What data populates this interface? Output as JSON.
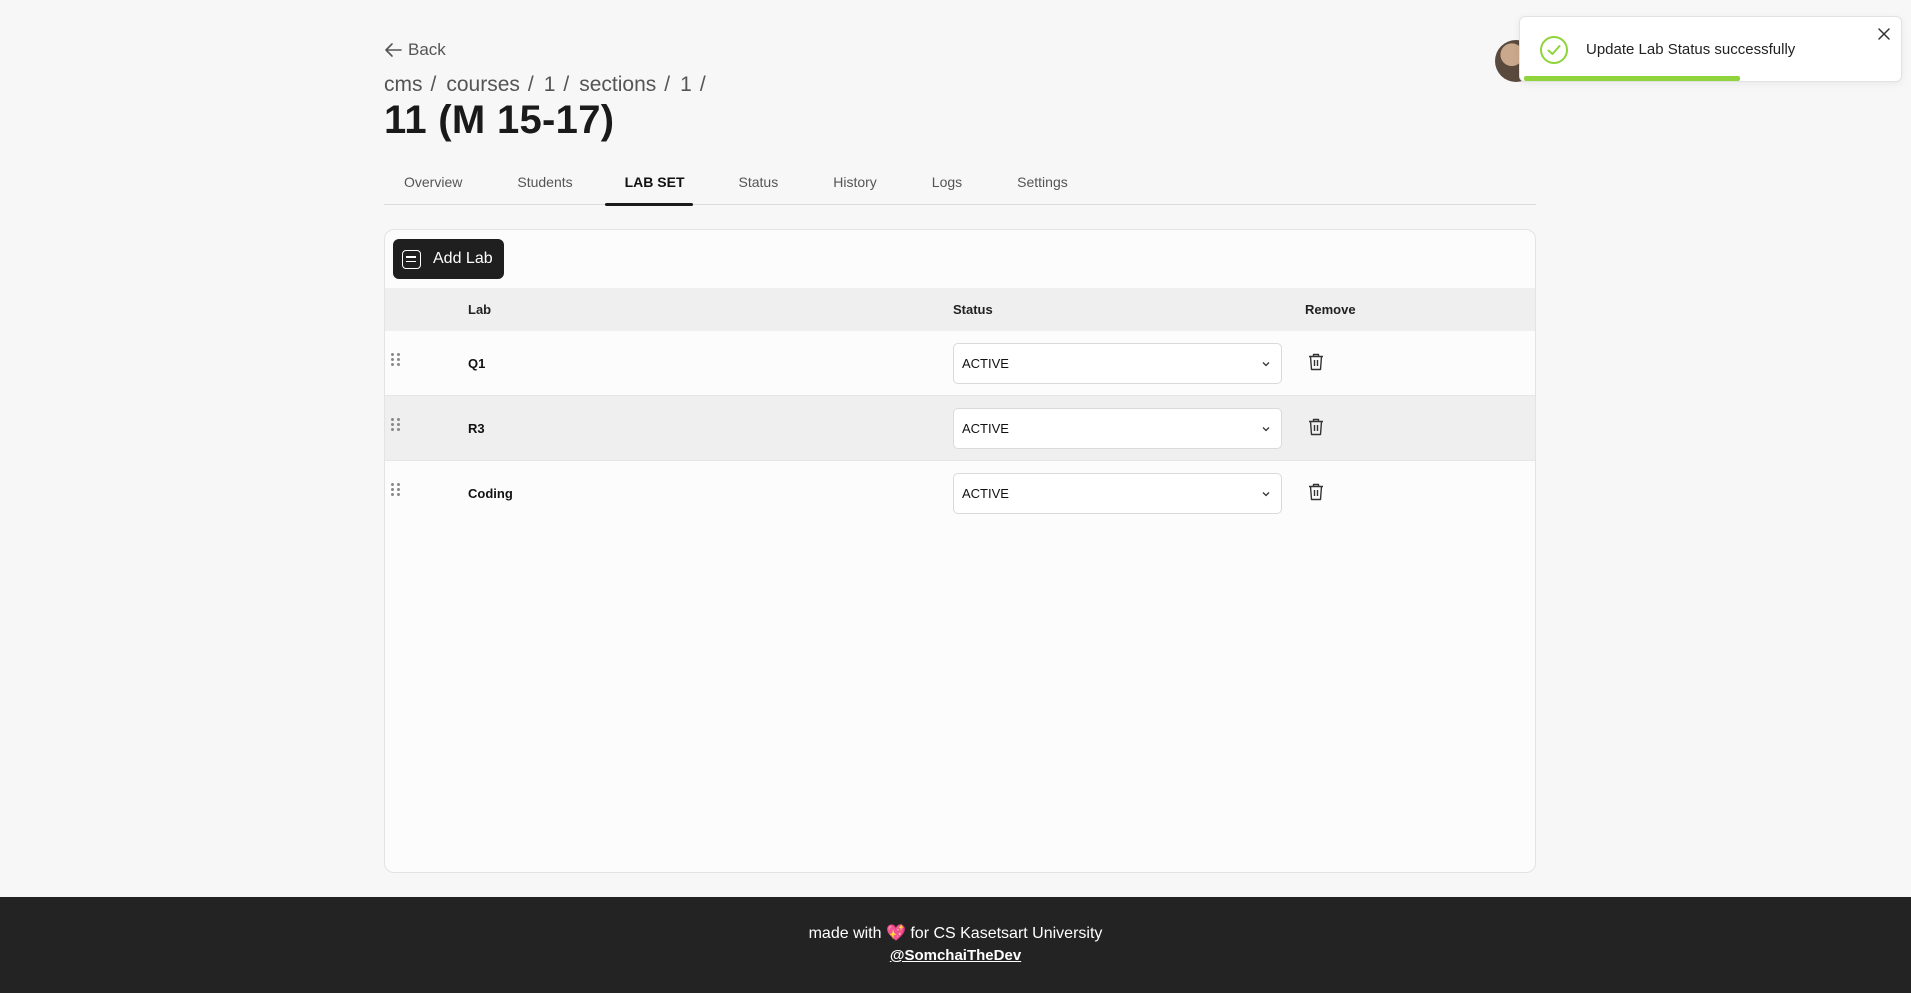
{
  "nav": {
    "back_label": "Back"
  },
  "breadcrumb": [
    {
      "label": "cms"
    },
    {
      "label": "courses"
    },
    {
      "label": "1"
    },
    {
      "label": "sections"
    },
    {
      "label": "1"
    }
  ],
  "breadcrumb_separator": "/",
  "page_title": "11 (M 15-17)",
  "tabs": [
    {
      "label": "Overview"
    },
    {
      "label": "Students"
    },
    {
      "label": "LAB SET",
      "active": true
    },
    {
      "label": "Status"
    },
    {
      "label": "History"
    },
    {
      "label": "Logs"
    },
    {
      "label": "Settings"
    }
  ],
  "toolbar": {
    "add_lab_label": "Add Lab"
  },
  "table": {
    "headers": {
      "lab": "Lab",
      "status": "Status",
      "remove": "Remove"
    },
    "rows": [
      {
        "lab": "Q1",
        "status": "ACTIVE"
      },
      {
        "lab": "R3",
        "status": "ACTIVE"
      },
      {
        "lab": "Coding",
        "status": "ACTIVE"
      }
    ]
  },
  "footer": {
    "text_before": "made with",
    "heart": "💖",
    "text_after": "for CS Kasetsart University",
    "handle": "@SomchaiTheDev"
  },
  "toast": {
    "message": "Update Lab Status successfully",
    "progress": 0.58,
    "accent_color": "#8ed43a"
  },
  "colors": {
    "primary_button": "#1f1f1f",
    "footer_bg": "#232323",
    "success": "#8ed43a"
  },
  "icons": {
    "back": "arrow-left-icon",
    "add_lab": "checklist-icon",
    "drag": "drag-handle-icon",
    "select": "chevron-down-icon",
    "remove": "trash-icon",
    "toast_status": "check-circle-icon",
    "toast_close": "close-icon"
  }
}
